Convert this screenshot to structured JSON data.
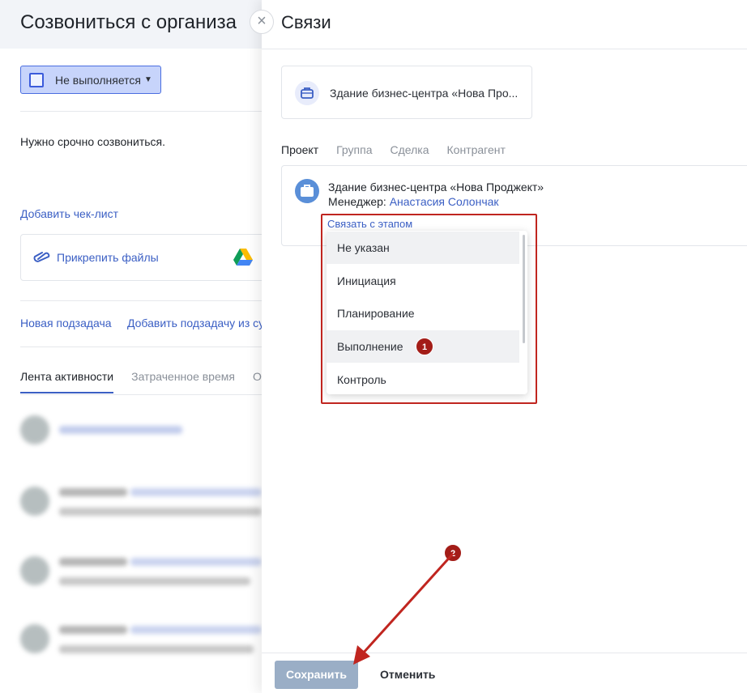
{
  "task": {
    "title": "Созвониться с организа",
    "status_label": "Не выполняется",
    "description": "Нужно срочно созвониться.",
    "add_checklist": "Добавить чек-лист",
    "attach_files": "Прикрепить файлы",
    "new_subtask": "Новая подзадача",
    "add_subtask_from": "Добавить подзадачу из су",
    "tabs": [
      "Лента активности",
      "Затраченное время",
      "От"
    ]
  },
  "panel": {
    "title": "Связи",
    "close_icon": "close-icon",
    "top_card_text": "Здание бизнес-центра «Нова Про...",
    "tabs": [
      "Проект",
      "Группа",
      "Сделка",
      "Контрагент"
    ],
    "project": {
      "name": "Здание бизнес-центра «Нова Проджект»",
      "manager_label": "Менеджер:",
      "manager_name": "Анастасия Солончак"
    },
    "stage_link": "Связать с этапом",
    "stages": [
      "Не указан",
      "Инициация",
      "Планирование",
      "Выполнение",
      "Контроль"
    ],
    "save": "Сохранить",
    "cancel": "Отменить"
  },
  "annotations": {
    "badge1": "1",
    "badge2": "2",
    "color": "#c0251f"
  }
}
